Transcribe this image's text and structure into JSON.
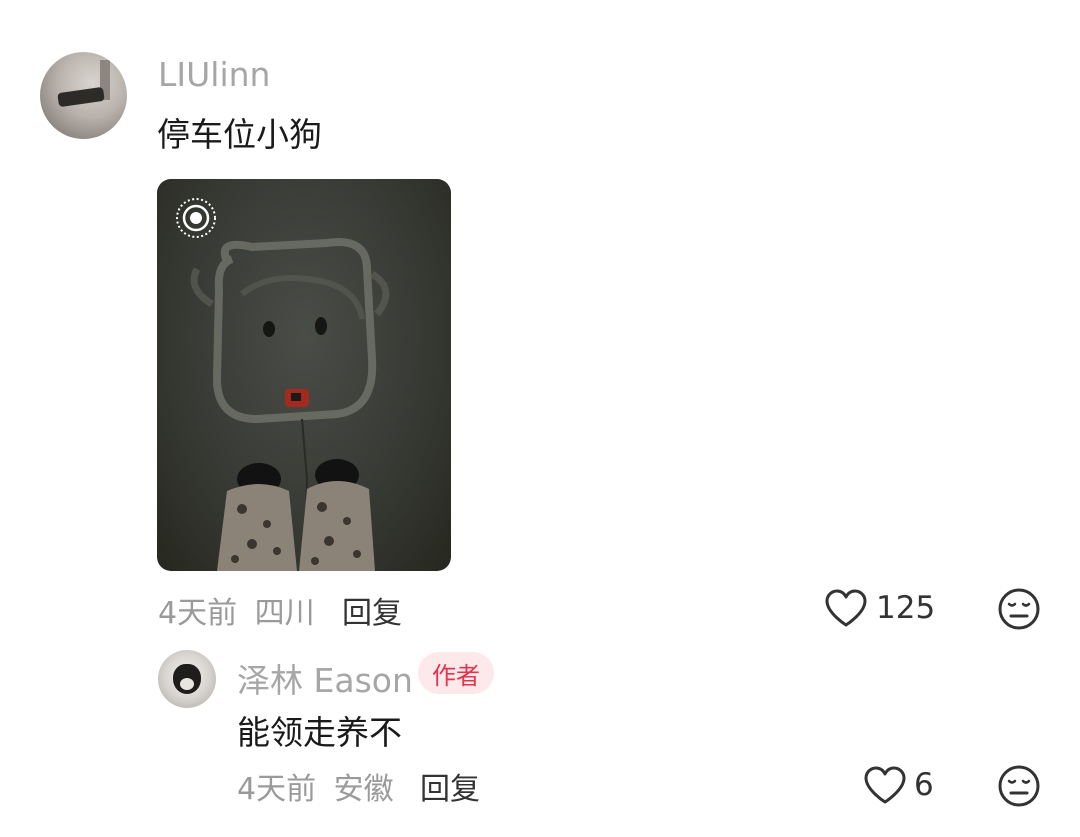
{
  "comment": {
    "username": "LIUlinn",
    "text": "停车位小狗",
    "time": "4天前",
    "location": "四川",
    "reply_label": "回复",
    "likes": "125"
  },
  "reply": {
    "username": "泽林 Eason",
    "badge": "作者",
    "text": "能领走养不",
    "time": "4天前",
    "location": "安徽",
    "reply_label": "回复",
    "likes": "6"
  },
  "icons": {
    "like": "heart-outline-icon",
    "dislike": "meh-face-icon",
    "live_photo": "live-photo-icon"
  },
  "colors": {
    "author_badge_bg": "#fde8ea",
    "author_badge_text": "#e2344d"
  }
}
